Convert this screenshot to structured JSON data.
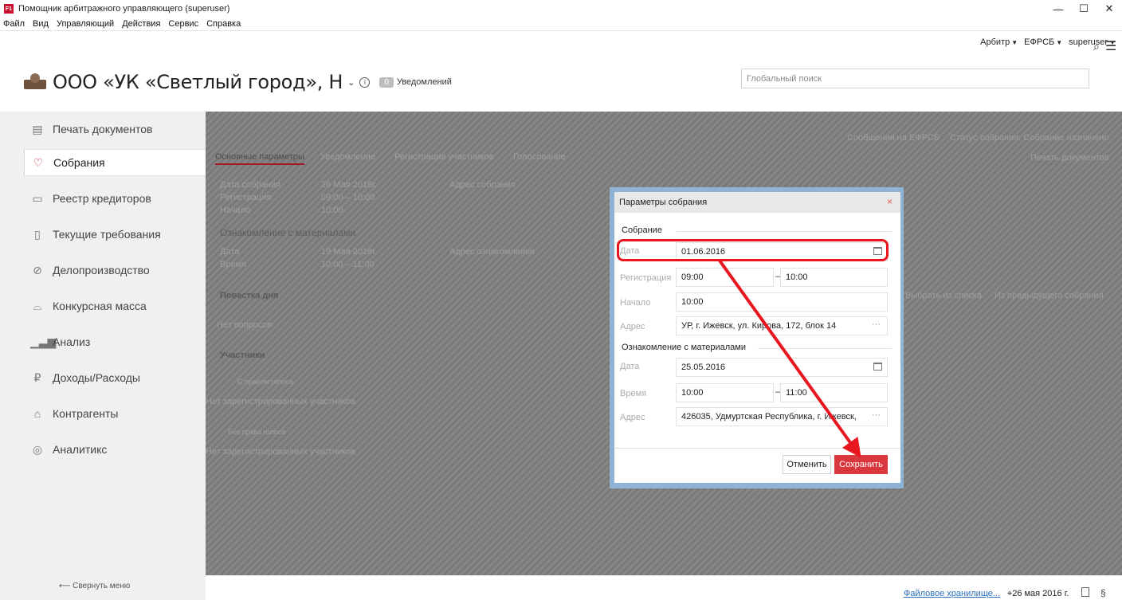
{
  "window": {
    "title": "Помощник арбитражного управляющего (superuser)",
    "app_icon": "F1",
    "controls": [
      "—",
      "☐",
      "✕"
    ]
  },
  "menu": [
    "Файл",
    "Вид",
    "Управляющий",
    "Действия",
    "Сервис",
    "Справка"
  ],
  "top_links": {
    "arbitr": "Арбитр",
    "efrsb": "ЕФРСБ",
    "user": "superuser"
  },
  "header": {
    "org_name": "ООО «УК «Светлый город», Н",
    "notifications_count": "0",
    "notifications_label": "Уведомлений",
    "search_placeholder": "Глобальный поиск"
  },
  "sidebar": {
    "items": [
      {
        "label": "Печать документов",
        "icon": "document-icon"
      },
      {
        "label": "Собрания",
        "icon": "handshake-icon"
      },
      {
        "label": "Реестр кредиторов",
        "icon": "id-card-icon"
      },
      {
        "label": "Текущие требования",
        "icon": "receipt-icon"
      },
      {
        "label": "Делопроизводство",
        "icon": "paperclip-icon"
      },
      {
        "label": "Конкурсная масса",
        "icon": "sofa-icon"
      },
      {
        "label": "Анализ",
        "icon": "bar-chart-icon"
      },
      {
        "label": "Доходы/Расходы",
        "icon": "ruble-icon"
      },
      {
        "label": "Контрагенты",
        "icon": "bank-icon"
      },
      {
        "label": "Аналитикс",
        "icon": "analytics-icon"
      }
    ],
    "active_index": 1,
    "collapse_label": "Свернуть меню"
  },
  "background": {
    "tabs": [
      "Основные параметры",
      "Уведомление",
      "Регистрация участников",
      "Голосование"
    ],
    "efrsb_messages": "Сообщения на ЕФРСБ",
    "meeting_status": "Статус собрания: Собрание назначено",
    "print_docs": "Печать документов",
    "meeting_date_label": "Дата собрания",
    "meeting_date": "26 Мая 2016г.",
    "registration_label": "Регистрация",
    "registration_time": "09:00 – 10:00",
    "start_label": "Начало",
    "start_time": "10:00",
    "address_label": "Адрес собрания",
    "acquaint_title": "Ознакомление с материалами",
    "acquaint_date_label": "Дата",
    "acquaint_date": "19 Мая 2016г.",
    "acquaint_time_label": "Время",
    "acquaint_time": "10:00 – 11:00",
    "acquaint_address_label": "Адрес ознакомления",
    "agenda_title": "Повестка дня",
    "no_questions": "Нет вопросов",
    "from_list": "Выбрать из списка",
    "from_prev": "Из предыдущего собрания",
    "participants_title": "Участники",
    "with_vote": "С правом голоса",
    "no_participants_1": "Нет зарегистрированных участников",
    "without_vote": "Без права голоса",
    "no_participants_2": "Нет зарегистрированных участников"
  },
  "dialog": {
    "title": "Параметры собрания",
    "section_meeting": "Собрание",
    "date_label": "Дата",
    "date_value": "01.06.2016",
    "registration_label": "Регистрация",
    "registration_from": "09:00",
    "registration_to": "10:00",
    "start_label": "Начало",
    "start_value": "10:00",
    "address_label": "Адрес",
    "address_value": "УР, г. Ижевск, ул. Кирова, 172, блок 14",
    "section_acquaint": "Ознакомление с материалами",
    "acq_date_label": "Дата",
    "acq_date_value": "25.05.2016",
    "acq_time_label": "Время",
    "acq_time_from": "10:00",
    "acq_time_to": "11:00",
    "acq_address_label": "Адрес",
    "acq_address_value": "426035, Удмуртская Республика, г. Ижевск,",
    "cancel_label": "Отменить",
    "save_label": "Сохранить",
    "close_glyph": "×",
    "dots": "···",
    "dash": "–"
  },
  "status_bar": {
    "file_storage": "Файловое хранилище...",
    "date": "26 мая 2016 г.",
    "paragraph_glyph": "§"
  },
  "colors": {
    "accent": "#d9363e",
    "highlight": "#e8161f",
    "link": "#2a6ebb",
    "dialog_frame": "#8fb3d3"
  }
}
